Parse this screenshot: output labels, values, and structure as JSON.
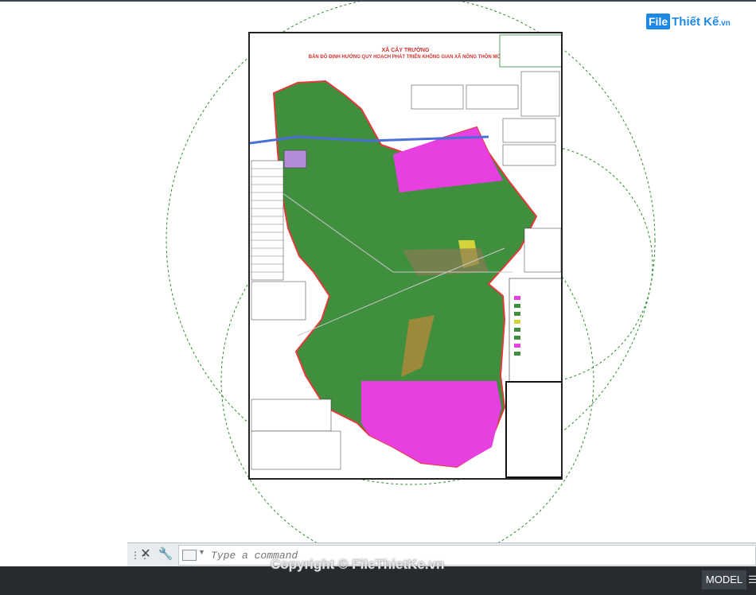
{
  "logo": {
    "prefix": "File",
    "name": "Thiết Kế",
    "suffix": ".vn"
  },
  "sheet": {
    "header_line": "",
    "commune": "XÃ CÂY TRƯỜNG",
    "map_title": "BẢN ĐỒ ĐỊNH HƯỚNG QUY HOẠCH PHÁT TRIỂN KHÔNG GIAN XÃ NÔNG THÔN MỚI"
  },
  "command": {
    "placeholder": "Type a command"
  },
  "watermark": "Copyright © FileThietKe.vn",
  "status": {
    "model_label": "MODEL",
    "grid_glyph": "☰"
  },
  "icons": {
    "grip": "grip-icon",
    "close": "close-icon",
    "customize": "wrench-icon",
    "command": "command-line-icon"
  },
  "colors": {
    "residential": "#3f8f3f",
    "industrial": "#e83fe0",
    "public": "#b28bd6",
    "commerce": "#d4d33a",
    "boundary": "#e23a3a",
    "circle": "#2e8b2e"
  }
}
